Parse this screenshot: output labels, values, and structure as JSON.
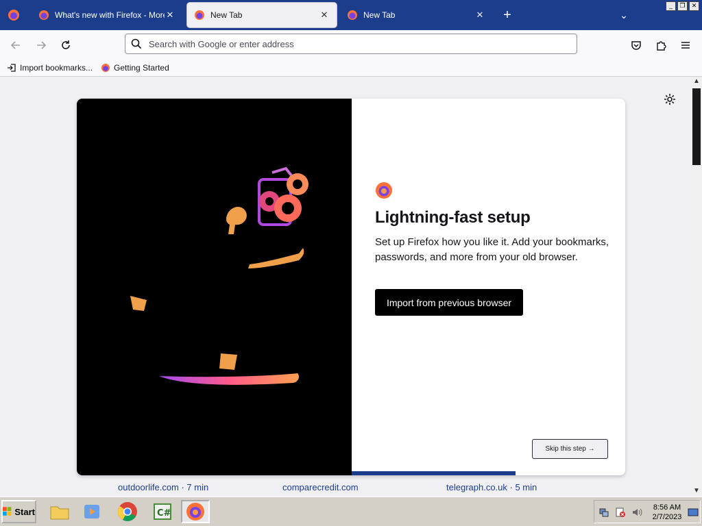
{
  "window": {
    "tabs": [
      {
        "title": "What's new with Firefox - More pri",
        "active": false
      },
      {
        "title": "New Tab",
        "active": true
      },
      {
        "title": "New Tab",
        "active": false
      }
    ],
    "controls": {
      "minimize": "_",
      "restore": "❐",
      "close": "✕"
    }
  },
  "navbar": {
    "url_placeholder": "Search with Google or enter address"
  },
  "bookmarks": [
    {
      "label": "Import bookmarks...",
      "icon": "import-icon"
    },
    {
      "label": "Getting Started",
      "icon": "firefox-icon"
    }
  ],
  "onboarding": {
    "title": "Lightning-fast setup",
    "body": "Set up Firefox how you like it. Add your bookmarks, passwords, and more from your old browser.",
    "primary_label": "Import from previous browser",
    "skip_label": "Skip this step →",
    "progress": 0.6
  },
  "stories": [
    "outdoorlife.com · 7 min",
    "comparecredit.com",
    "telegraph.co.uk · 5 min"
  ],
  "taskbar": {
    "start_label": "Start",
    "time": "8:56 AM",
    "date": "2/7/2023"
  },
  "colors": {
    "accent": "#1c3c8c",
    "tabstrip": "#1c3c8c",
    "modal_art_bg": "#000000"
  }
}
